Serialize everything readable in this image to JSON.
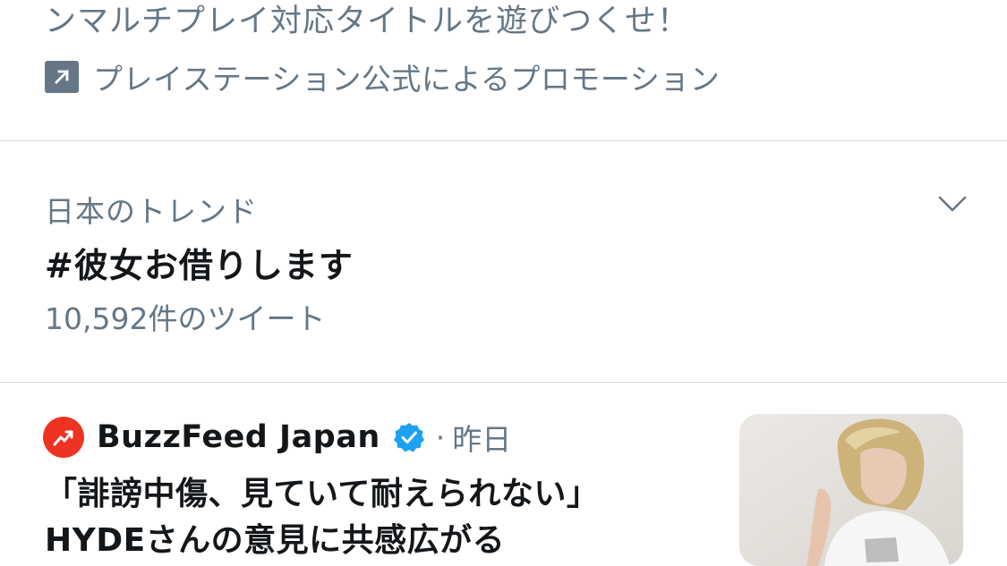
{
  "promo": {
    "text": "ンマルチプレイ対応タイトルを遊びつくせ！",
    "label": "プレイステーション公式によるプロモーション",
    "icon": "promoted-arrow-icon"
  },
  "trend": {
    "context": "日本のトレンド",
    "title": "#彼女お借りします",
    "count": "10,592件のツイート",
    "menu_icon": "chevron-down-icon"
  },
  "news": {
    "source": "BuzzFeed Japan",
    "separator": "·",
    "time": "昨日",
    "headline_line1": "「誹謗中傷、見ていて耐えられない」",
    "headline_line2": "HYDEさんの意見に共感広がる",
    "avatar_icon": "trending-arrow-icon",
    "verified_icon": "verified-badge-icon"
  },
  "colors": {
    "secondary_text": "#657786",
    "primary_text": "#14171a",
    "verified_blue": "#1da1f2",
    "buzzfeed_red": "#ee3322",
    "divider": "#d9d9d9"
  }
}
